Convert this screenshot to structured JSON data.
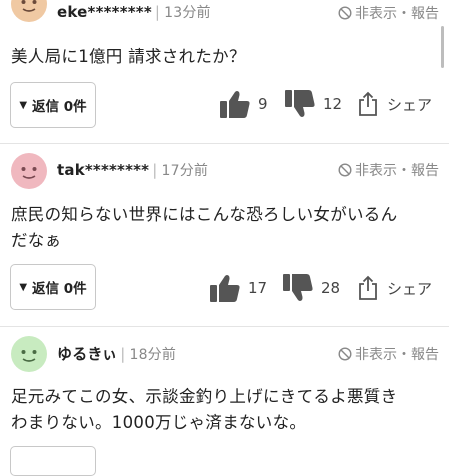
{
  "comments": [
    {
      "user": "eke********",
      "time": "13分前",
      "hide_report": "非表示・報告",
      "text": "美人局に1億円 請求されたか？",
      "reply_label": "返信 0件",
      "likes": "9",
      "dislikes": "12",
      "share_label": "シェア",
      "avatar_color": "#f0c9a3"
    },
    {
      "user": "tak********",
      "time": "17分前",
      "hide_report": "非表示・報告",
      "text": "庶民の知らない世界にはこんな恐ろしい女がいるん\nだなぁ",
      "reply_label": "返信 0件",
      "likes": "17",
      "dislikes": "28",
      "share_label": "シェア",
      "avatar_color": "#f0b8bf"
    },
    {
      "user": "ゆるきぃ",
      "time": "18分前",
      "hide_report": "非表示・報告",
      "text": "足元みてこの女、示談金釣り上げにきてるよ悪質き\nわまりない。1000万じゃ済まないな。",
      "avatar_color": "#c8ebc0"
    }
  ],
  "colors": {
    "icon_gray": "#555555",
    "text_gray": "#888888"
  }
}
